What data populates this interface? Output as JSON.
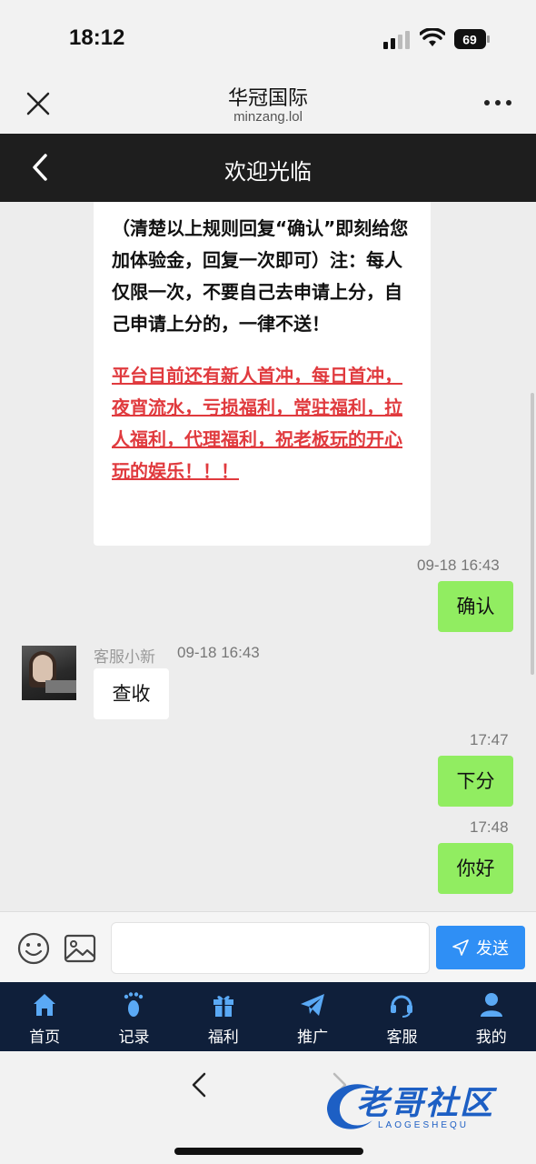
{
  "status_bar": {
    "time": "18:12",
    "battery": "69"
  },
  "browser": {
    "title": "华冠国际",
    "domain": "minzang.lol"
  },
  "nav": {
    "title": "欢迎光临"
  },
  "messages": {
    "card_black": "（清楚以上规则回复“确认”即刻给您加体验金，回复一次即可）注：每人仅限一次，不要自己去申请上分，自己申请上分的，一律不送！",
    "card_red": "平台目前还有新人首冲，每日首冲，夜宵流水，亏损福利，常驻福利，拉人福利，代理福利，祝老板玩的开心 玩的娱乐！！！",
    "time1": "09-18 16:43",
    "bubble1": "确认",
    "sender_name": "客服小新",
    "sender_time": "09-18 16:43",
    "reply1": "查收",
    "time2": "17:47",
    "bubble2": "下分",
    "time3": "17:48",
    "bubble3": "你好"
  },
  "input": {
    "placeholder": "",
    "send_label": "发送"
  },
  "tabs": [
    {
      "label": "首页",
      "icon": "home-icon"
    },
    {
      "label": "记录",
      "icon": "footprint-icon"
    },
    {
      "label": "福利",
      "icon": "gift-icon"
    },
    {
      "label": "推广",
      "icon": "paper-plane-icon"
    },
    {
      "label": "客服",
      "icon": "headset-icon"
    },
    {
      "label": "我的",
      "icon": "user-icon"
    }
  ],
  "watermark": {
    "text": "老哥社区",
    "sub": "LAOGESHEQU"
  },
  "colors": {
    "bubble_me": "#91ed61",
    "send_button": "#2f8ff5",
    "tab_bar": "#0f1f3a",
    "warning_red": "#e03a3e"
  }
}
